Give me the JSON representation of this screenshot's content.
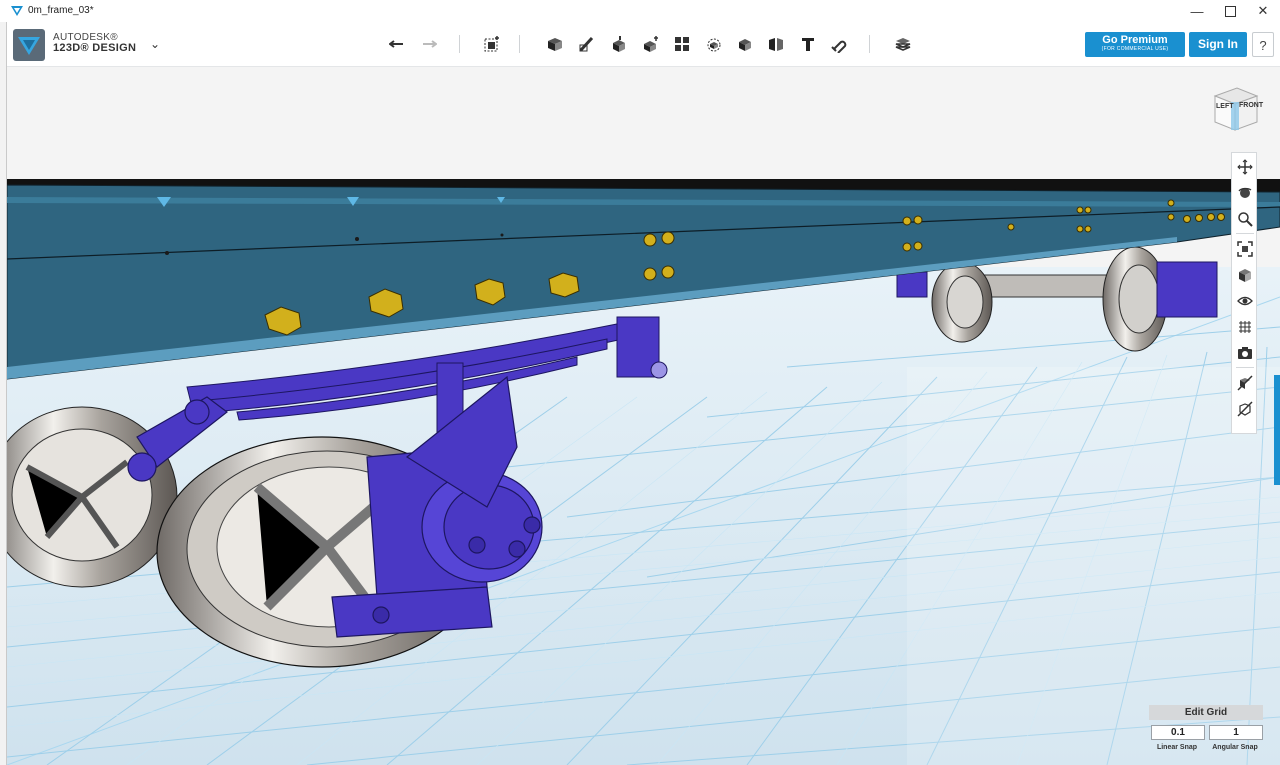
{
  "window": {
    "title": "0m_frame_03*",
    "minimize_icon": "minimize-icon",
    "maximize_icon": "maximize-icon",
    "close_icon": "close-icon"
  },
  "app": {
    "brand_line1": "AUTODESK®",
    "brand_line2": "123D® DESIGN",
    "menu_icon": "chevron-down-icon"
  },
  "toolbar": {
    "tools": [
      {
        "name": "undo",
        "icon": "undo-icon"
      },
      {
        "name": "redo",
        "icon": "redo-icon"
      },
      {
        "name": "transform",
        "icon": "transform-icon"
      },
      {
        "name": "primitives",
        "icon": "primitives-icon"
      },
      {
        "name": "sketch",
        "icon": "sketch-icon"
      },
      {
        "name": "construct",
        "icon": "construct-icon"
      },
      {
        "name": "modify",
        "icon": "modify-icon"
      },
      {
        "name": "pattern",
        "icon": "pattern-icon"
      },
      {
        "name": "grouping",
        "icon": "grouping-icon"
      },
      {
        "name": "combine",
        "icon": "combine-icon"
      },
      {
        "name": "measure",
        "icon": "measure-icon"
      },
      {
        "name": "text",
        "icon": "text-icon"
      },
      {
        "name": "snap",
        "icon": "snap-icon"
      },
      {
        "name": "material",
        "icon": "material-icon"
      }
    ],
    "premium_label": "Go Premium",
    "premium_sublabel": "(FOR COMMERCIAL USE)",
    "signin_label": "Sign In",
    "help_label": "?"
  },
  "viewcube": {
    "left_label": "LEFT",
    "front_label": "FRONT"
  },
  "navbar": {
    "buttons": [
      {
        "name": "pan",
        "icon": "pan-icon"
      },
      {
        "name": "orbit",
        "icon": "orbit-icon"
      },
      {
        "name": "zoom",
        "icon": "zoom-icon"
      },
      {
        "name": "fit",
        "icon": "fit-icon"
      },
      {
        "name": "views",
        "icon": "view-cube-icon"
      },
      {
        "name": "visibility",
        "icon": "eye-icon"
      },
      {
        "name": "grid-visibility",
        "icon": "grid-icon"
      },
      {
        "name": "screenshot",
        "icon": "camera-icon"
      },
      {
        "name": "materials-off",
        "icon": "materials-off-icon"
      },
      {
        "name": "outlines-off",
        "icon": "outlines-off-icon"
      }
    ]
  },
  "grid_panel": {
    "title": "Edit Grid",
    "linear_snap_value": "0.1",
    "angular_snap_value": "1",
    "linear_snap_label": "Linear Snap",
    "angular_snap_label": "Angular Snap"
  },
  "colors": {
    "accent": "#1a90d0",
    "frame_blue": "#2f6580",
    "chassis_purple": "#4a38c4",
    "floor": "#dce8f0",
    "sky": "#f4f4f4"
  }
}
